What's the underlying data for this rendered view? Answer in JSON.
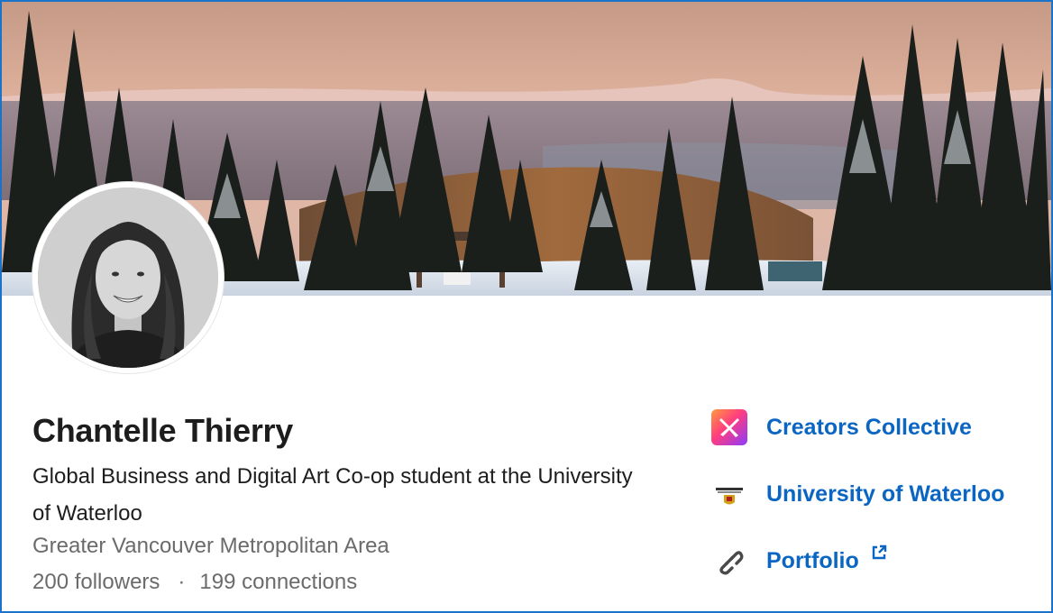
{
  "profile": {
    "name": "Chantelle Thierry",
    "headline": "Global Business and Digital Art Co-op student at the University of Waterloo",
    "location": "Greater Vancouver Metropolitan Area",
    "followers": "200 followers",
    "separator": "·",
    "connections": "199 connections"
  },
  "links": [
    {
      "label": "Creators Collective",
      "icon": "creators-collective-logo"
    },
    {
      "label": "University of Waterloo",
      "icon": "university-of-waterloo-logo"
    },
    {
      "label": "Portfolio",
      "icon": "link-icon",
      "external_icon": "external-link-icon"
    }
  ],
  "colors": {
    "link": "#0a66c2",
    "text": "#1d1d1d",
    "muted": "#6b6b6b",
    "frame_border": "#1a73c8"
  }
}
